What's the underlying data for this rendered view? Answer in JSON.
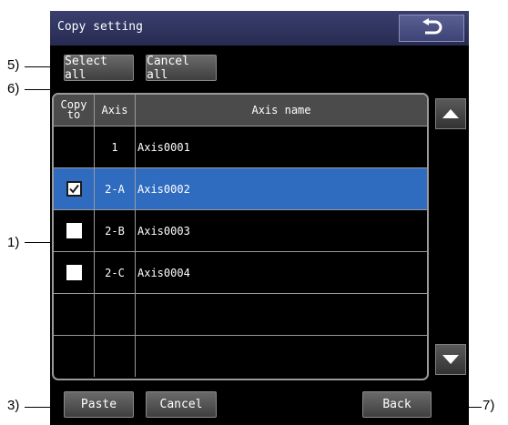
{
  "window": {
    "title": "Copy setting"
  },
  "toolbar": {
    "select_all_label": "Select all",
    "cancel_all_label": "Cancel all"
  },
  "table": {
    "headers": {
      "copy_to": "Copy\nto",
      "axis": "Axis",
      "axis_name": "Axis name"
    },
    "rows": [
      {
        "checkbox": "none",
        "axis": "1",
        "name": "Axis0001",
        "selected": false
      },
      {
        "checkbox": "checked",
        "axis": "2-A",
        "name": "Axis0002",
        "selected": true
      },
      {
        "checkbox": "unchecked",
        "axis": "2-B",
        "name": "Axis0003",
        "selected": false
      },
      {
        "checkbox": "unchecked",
        "axis": "2-C",
        "name": "Axis0004",
        "selected": false
      },
      {
        "checkbox": "none",
        "axis": "",
        "name": "",
        "selected": false
      },
      {
        "checkbox": "none",
        "axis": "",
        "name": "",
        "selected": false
      }
    ]
  },
  "footer": {
    "paste_label": "Paste",
    "cancel_label": "Cancel",
    "back_label": "Back"
  },
  "callouts": {
    "c1": "1)",
    "c3": "3)",
    "c5": "5)",
    "c6": "6)",
    "c7": "7)"
  },
  "icons": {
    "return": "return-arrow-icon",
    "scroll_up": "triangle-up-icon",
    "scroll_down": "triangle-down-icon",
    "check": "checkmark-icon"
  },
  "colors": {
    "titlebar": "#2f3462",
    "selected_row": "#2f6cc0",
    "screen_bg": "#000000"
  }
}
